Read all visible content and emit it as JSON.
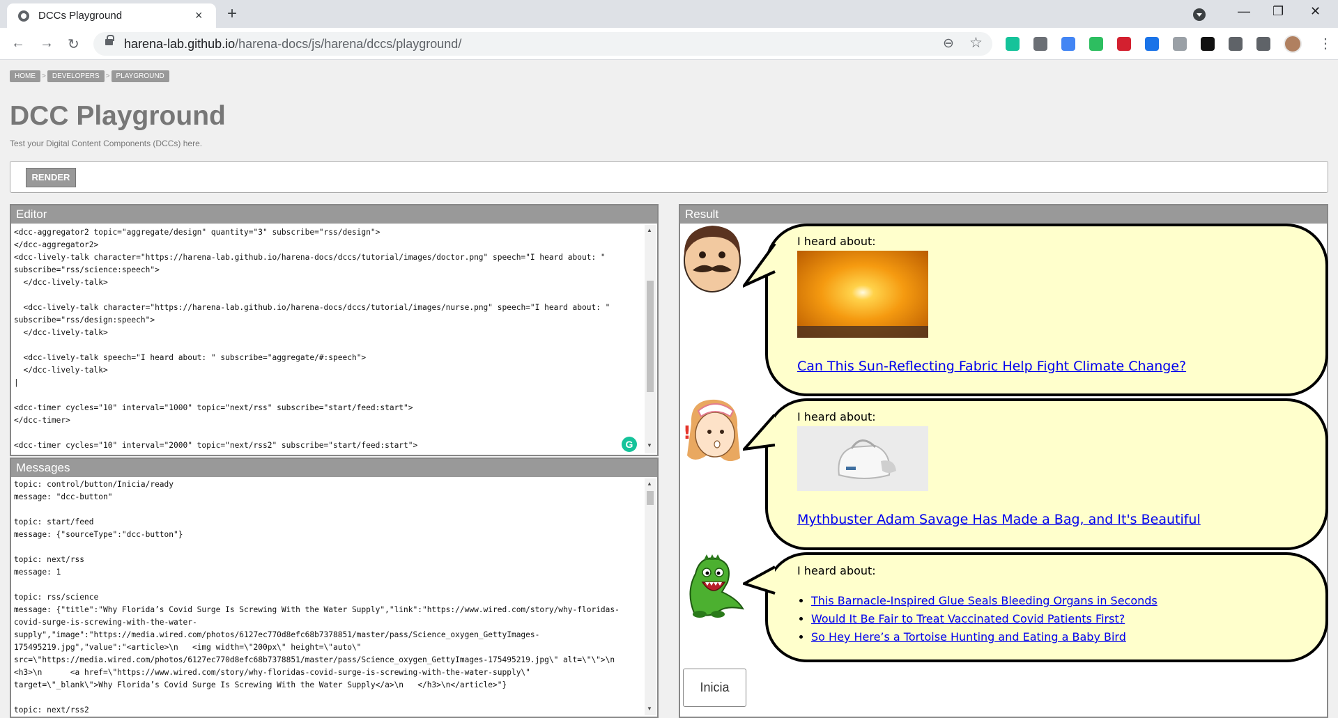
{
  "browser": {
    "tab_title": "DCCs Playground",
    "close_glyph": "×",
    "new_tab_glyph": "+",
    "url_host": "harena-lab.github.io",
    "url_path": "/harena-docs/js/harena/dccs/playground/",
    "back_glyph": "←",
    "forward_glyph": "→",
    "reload_glyph": "↻",
    "zoom_glyph": "⊖",
    "star_glyph": "☆",
    "kebab_glyph": "⋮",
    "minimize_glyph": "—",
    "restore_glyph": "❐",
    "window_close_glyph": "✕",
    "extensions": [
      {
        "name": "grammarly-icon",
        "color": "#15c39a"
      },
      {
        "name": "camera-extension-icon",
        "color": "#6b6f75"
      },
      {
        "name": "translate-icon",
        "color": "#4285f4"
      },
      {
        "name": "evernote-icon",
        "color": "#2dbe60"
      },
      {
        "name": "mendeley-icon",
        "color": "#d3202f"
      },
      {
        "name": "shield-extension-icon",
        "color": "#1a73e8"
      },
      {
        "name": "document-extension-icon",
        "color": "#9aa0a6"
      },
      {
        "name": "notion-icon",
        "color": "#111111"
      },
      {
        "name": "puzzle-extensions-icon",
        "color": "#5f6368"
      },
      {
        "name": "reading-list-icon",
        "color": "#5f6368"
      }
    ]
  },
  "page": {
    "breadcrumbs": [
      "HOME",
      "DEVELOPERS",
      "PLAYGROUND"
    ],
    "crumb_sep": ">",
    "title": "DCC Playground",
    "subtitle": "Test your Digital Content Components (DCCs) here.",
    "render_label": "RENDER"
  },
  "editor": {
    "header": "Editor",
    "code": "<dcc-aggregator2 topic=\"aggregate/design\" quantity=\"3\" subscribe=\"rss/design\">\n</dcc-aggregator2>\n<dcc-lively-talk character=\"https://harena-lab.github.io/harena-docs/dccs/tutorial/images/doctor.png\" speech=\"I heard about: \"\nsubscribe=\"rss/science:speech\">\n  </dcc-lively-talk>\n\n  <dcc-lively-talk character=\"https://harena-lab.github.io/harena-docs/dccs/tutorial/images/nurse.png\" speech=\"I heard about: \"\nsubscribe=\"rss/design:speech\">\n  </dcc-lively-talk>\n\n  <dcc-lively-talk speech=\"I heard about: \" subscribe=\"aggregate/#:speech\">\n  </dcc-lively-talk>\n|\n\n<dcc-timer cycles=\"10\" interval=\"1000\" topic=\"next/rss\" subscribe=\"start/feed:start\">\n</dcc-timer>\n\n<dcc-timer cycles=\"10\" interval=\"2000\" topic=\"next/rss2\" subscribe=\"start/feed:start\">"
  },
  "messages": {
    "header": "Messages",
    "log": "topic: control/button/Inicia/ready\nmessage: \"dcc-button\"\n\ntopic: start/feed\nmessage: {\"sourceType\":\"dcc-button\"}\n\ntopic: next/rss\nmessage: 1\n\ntopic: rss/science\nmessage: {\"title\":\"Why Florida’s Covid Surge Is Screwing With the Water Supply\",\"link\":\"https://www.wired.com/story/why-floridas-\ncovid-surge-is-screwing-with-the-water-\nsupply\",\"image\":\"https://media.wired.com/photos/6127ec770d8efc68b7378851/master/pass/Science_oxygen_GettyImages-\n175495219.jpg\",\"value\":\"<article>\\n   <img width=\\\"200px\\\" height=\\\"auto\\\"\nsrc=\\\"https://media.wired.com/photos/6127ec770d8efc68b7378851/master/pass/Science_oxygen_GettyImages-175495219.jpg\\\" alt=\\\"\\\">\\n\n<h3>\\n      <a href=\\\"https://www.wired.com/story/why-floridas-covid-surge-is-screwing-with-the-water-supply\\\"\ntarget=\\\"_blank\\\">Why Florida’s Covid Surge Is Screwing With the Water Supply</a>\\n   </h3>\\n</article>\"}\n\ntopic: next/rss2"
  },
  "result": {
    "header": "Result",
    "talks": [
      {
        "speech": "I heard about:",
        "link": "Can This Sun-Reflecting Fabric Help Fight Climate Change?"
      },
      {
        "speech": "I heard about:",
        "link": "Mythbuster Adam Savage Has Made a Bag, and It's Beautiful"
      },
      {
        "speech": "I heard about:",
        "items": [
          "This Barnacle-Inspired Glue Seals Bleeding Organs in Seconds",
          "Would It Be Fair to Treat Vaccinated Covid Patients First?",
          "So Hey Here’s a Tortoise Hunting and Eating a Baby Bird"
        ]
      }
    ],
    "button_label": "Inicia"
  },
  "colors": {
    "bubble_fill": "#ffffcc",
    "panel_header": "#999999",
    "link": "#0000ee"
  }
}
